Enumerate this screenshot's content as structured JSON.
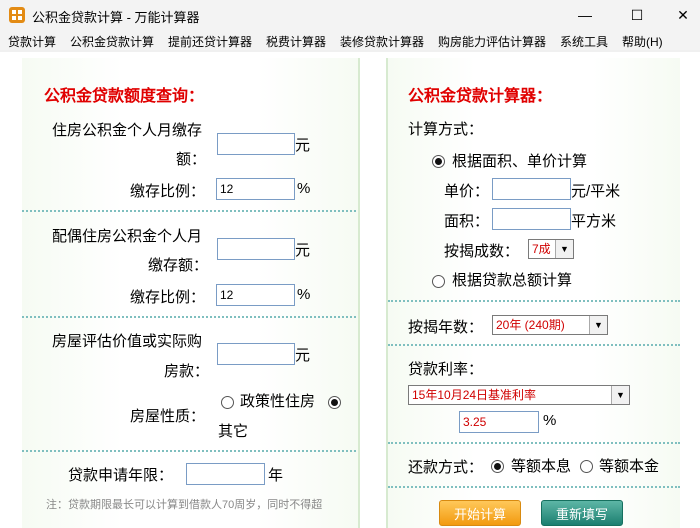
{
  "window": {
    "title": "公积金贷款计算 - 万能计算器",
    "minimize_glyph": "—",
    "maximize_glyph": "☐",
    "close_glyph": "✕"
  },
  "menu": [
    "贷款计算",
    "公积金贷款计算",
    "提前还贷计算器",
    "税费计算器",
    "装修贷款计算器",
    "购房能力评估计算器",
    "系统工具",
    "帮助(H)"
  ],
  "left": {
    "heading": "公积金贷款额度查询：",
    "monthly_deposit_label_1": "住房公积金个人月缴存",
    "monthly_deposit_label_2": "额：",
    "monthly_deposit_value": "",
    "unit_yuan": "元",
    "deposit_ratio_label": "缴存比例：",
    "deposit_ratio_value": "12",
    "unit_percent": "%",
    "spouse_deposit_label_1": "配偶住房公积金个人月",
    "spouse_deposit_label_2": "缴存额：",
    "spouse_deposit_value": "",
    "spouse_ratio_label": "缴存比例：",
    "spouse_ratio_value": "12",
    "house_price_label_1": "房屋评估价值或实际购",
    "house_price_label_2": "房款：",
    "house_price_value": "",
    "house_type_label": "房屋性质：",
    "house_type_option_1": "政策性住房",
    "house_type_option_2": "其它",
    "loan_years_label": "贷款申请年限：",
    "loan_years_value": "",
    "unit_year": "年",
    "note": "注：贷款期限最长可以计算到借款人70周岁，同时不得超"
  },
  "right": {
    "heading": "公积金贷款计算器：",
    "method_label": "计算方式：",
    "method_option_1": "根据面积、单价计算",
    "unit_price_label": "单价：",
    "unit_price_value": "",
    "unit_price_unit": "元/平米",
    "area_label": "面积：",
    "area_value": "",
    "area_unit": "平方米",
    "mortgage_ratio_label": "按揭成数：",
    "mortgage_ratio_value": "7成",
    "method_option_2": "根据贷款总额计算",
    "mortgage_years_label": "按揭年数：",
    "mortgage_years_value": "20年 (240期)",
    "rate_label": "贷款利率：",
    "rate_select_value": "15年10月24日基准利率",
    "rate_value": "3.25",
    "rate_unit": "%",
    "repay_label": "还款方式：",
    "repay_option_1": "等额本息",
    "repay_option_2": "等额本金",
    "calc_button": "开始计算",
    "reset_button": "重新填写"
  }
}
